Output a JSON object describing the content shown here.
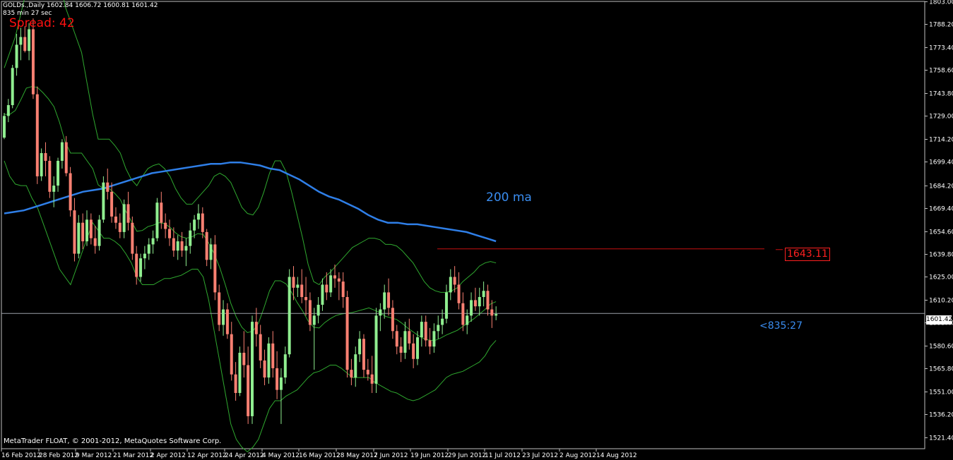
{
  "header": {
    "line1": "GOLDs.,Daily  1602.84 1606.72 1600.81 1601.42",
    "line2": "835 min 27 sec"
  },
  "spread_label": "Spread: 42",
  "ma_label": "200 ma",
  "countdown_label": "<835:27",
  "level_label": "1643.11",
  "copyright": "MetaTrader FLOAT, © 2001-2012, MetaQuotes Software Corp.",
  "current_price_label": "1601.42",
  "colors": {
    "background": "#000000",
    "bull_candle": "#90ee90",
    "bear_candle": "#fa8072",
    "bollinger": "#2fa82f",
    "ma200": "#2f7fe8",
    "level_line": "#c81010",
    "axis": "#c0c0c0",
    "price_line": "#9aa0a8"
  },
  "chart_data": {
    "type": "candlestick",
    "symbol": "GOLDs.",
    "timeframe": "Daily",
    "ylim": [
      1514,
      1803
    ],
    "y_ticks": [
      "1803.00",
      "1788.20",
      "1773.40",
      "1758.60",
      "1743.80",
      "1729.00",
      "1714.20",
      "1699.40",
      "1684.20",
      "1669.40",
      "1654.60",
      "1639.80",
      "1625.00",
      "1610.20",
      "1595.40",
      "1580.60",
      "1565.80",
      "1551.00",
      "1536.20",
      "1521.40"
    ],
    "x_tick_labels": [
      "16 Feb 2012",
      "28 Feb 2012",
      "9 Mar 2012",
      "21 Mar 2012",
      "2 Apr 2012",
      "12 Apr 2012",
      "24 Apr 2012",
      "4 May 2012",
      "16 May 2012",
      "28 May 2012",
      "7 Jun 2012",
      "19 Jun 2012",
      "29 Jun 2012",
      "11 Jul 2012",
      "23 Jul 2012",
      "2 Aug 2012",
      "14 Aug 2012"
    ],
    "x_tick_index": [
      0,
      9,
      18,
      27,
      36,
      45,
      54,
      63,
      72,
      81,
      90,
      99,
      108,
      117,
      126,
      135,
      144
    ],
    "candles": [
      [
        1715,
        1731,
        1714,
        1729
      ],
      [
        1729,
        1740,
        1725,
        1736
      ],
      [
        1736,
        1762,
        1734,
        1760
      ],
      [
        1760,
        1782,
        1755,
        1775
      ],
      [
        1775,
        1786,
        1765,
        1780
      ],
      [
        1780,
        1787,
        1770,
        1771
      ],
      [
        1771,
        1789,
        1765,
        1785
      ],
      [
        1785,
        1792,
        1740,
        1743
      ],
      [
        1743,
        1748,
        1685,
        1690
      ],
      [
        1690,
        1708,
        1687,
        1705
      ],
      [
        1705,
        1712,
        1690,
        1700
      ],
      [
        1700,
        1703,
        1676,
        1680
      ],
      [
        1680,
        1690,
        1670,
        1684
      ],
      [
        1684,
        1702,
        1680,
        1700
      ],
      [
        1700,
        1714,
        1695,
        1712
      ],
      [
        1712,
        1716,
        1690,
        1692
      ],
      [
        1692,
        1696,
        1664,
        1668
      ],
      [
        1668,
        1676,
        1635,
        1640
      ],
      [
        1640,
        1665,
        1637,
        1660
      ],
      [
        1660,
        1666,
        1643,
        1648
      ],
      [
        1648,
        1668,
        1645,
        1662
      ],
      [
        1662,
        1666,
        1646,
        1650
      ],
      [
        1650,
        1658,
        1640,
        1645
      ],
      [
        1645,
        1665,
        1642,
        1662
      ],
      [
        1662,
        1690,
        1660,
        1686
      ],
      [
        1686,
        1695,
        1675,
        1680
      ],
      [
        1680,
        1686,
        1660,
        1664
      ],
      [
        1664,
        1670,
        1656,
        1660
      ],
      [
        1660,
        1666,
        1650,
        1654
      ],
      [
        1654,
        1675,
        1650,
        1672
      ],
      [
        1672,
        1680,
        1655,
        1660
      ],
      [
        1660,
        1664,
        1636,
        1640
      ],
      [
        1640,
        1645,
        1620,
        1625
      ],
      [
        1625,
        1640,
        1622,
        1637
      ],
      [
        1637,
        1645,
        1630,
        1640
      ],
      [
        1640,
        1650,
        1636,
        1646
      ],
      [
        1646,
        1655,
        1640,
        1650
      ],
      [
        1650,
        1676,
        1648,
        1673
      ],
      [
        1673,
        1680,
        1656,
        1660
      ],
      [
        1660,
        1666,
        1650,
        1656
      ],
      [
        1656,
        1662,
        1645,
        1650
      ],
      [
        1650,
        1657,
        1638,
        1642
      ],
      [
        1642,
        1652,
        1636,
        1648
      ],
      [
        1648,
        1654,
        1638,
        1642
      ],
      [
        1642,
        1650,
        1632,
        1645
      ],
      [
        1645,
        1660,
        1640,
        1655
      ],
      [
        1655,
        1665,
        1650,
        1662
      ],
      [
        1662,
        1672,
        1656,
        1666
      ],
      [
        1666,
        1670,
        1650,
        1654
      ],
      [
        1654,
        1656,
        1632,
        1636
      ],
      [
        1636,
        1650,
        1630,
        1646
      ],
      [
        1646,
        1652,
        1610,
        1615
      ],
      [
        1615,
        1620,
        1590,
        1594
      ],
      [
        1594,
        1610,
        1587,
        1604
      ],
      [
        1604,
        1608,
        1585,
        1588
      ],
      [
        1588,
        1596,
        1558,
        1562
      ],
      [
        1562,
        1570,
        1545,
        1550
      ],
      [
        1550,
        1580,
        1548,
        1576
      ],
      [
        1576,
        1590,
        1560,
        1568
      ],
      [
        1568,
        1580,
        1530,
        1535
      ],
      [
        1535,
        1600,
        1530,
        1596
      ],
      [
        1596,
        1605,
        1580,
        1588
      ],
      [
        1588,
        1594,
        1566,
        1571
      ],
      [
        1571,
        1578,
        1555,
        1560
      ],
      [
        1560,
        1586,
        1556,
        1582
      ],
      [
        1582,
        1590,
        1560,
        1566
      ],
      [
        1566,
        1577,
        1546,
        1552
      ],
      [
        1552,
        1566,
        1530,
        1560
      ],
      [
        1560,
        1580,
        1556,
        1575
      ],
      [
        1575,
        1630,
        1573,
        1625
      ],
      [
        1625,
        1632,
        1610,
        1618
      ],
      [
        1618,
        1625,
        1612,
        1620
      ],
      [
        1620,
        1630,
        1608,
        1612
      ],
      [
        1612,
        1625,
        1600,
        1610
      ],
      [
        1610,
        1615,
        1590,
        1594
      ],
      [
        1594,
        1605,
        1565,
        1600
      ],
      [
        1600,
        1612,
        1595,
        1607
      ],
      [
        1607,
        1624,
        1603,
        1620
      ],
      [
        1620,
        1628,
        1610,
        1615
      ],
      [
        1615,
        1630,
        1612,
        1626
      ],
      [
        1626,
        1633,
        1618,
        1624
      ],
      [
        1624,
        1628,
        1610,
        1622
      ],
      [
        1622,
        1628,
        1605,
        1612
      ],
      [
        1612,
        1616,
        1560,
        1565
      ],
      [
        1565,
        1572,
        1555,
        1560
      ],
      [
        1560,
        1580,
        1554,
        1575
      ],
      [
        1575,
        1590,
        1570,
        1585
      ],
      [
        1585,
        1588,
        1560,
        1565
      ],
      [
        1565,
        1572,
        1558,
        1562
      ],
      [
        1562,
        1574,
        1550,
        1556
      ],
      [
        1556,
        1605,
        1550,
        1600
      ],
      [
        1600,
        1608,
        1590,
        1604
      ],
      [
        1604,
        1620,
        1598,
        1615
      ],
      [
        1615,
        1624,
        1600,
        1605
      ],
      [
        1605,
        1610,
        1585,
        1590
      ],
      [
        1590,
        1594,
        1575,
        1580
      ],
      [
        1580,
        1586,
        1570,
        1576
      ],
      [
        1576,
        1596,
        1572,
        1590
      ],
      [
        1590,
        1598,
        1578,
        1582
      ],
      [
        1582,
        1588,
        1566,
        1572
      ],
      [
        1572,
        1590,
        1568,
        1586
      ],
      [
        1586,
        1600,
        1580,
        1596
      ],
      [
        1596,
        1600,
        1580,
        1584
      ],
      [
        1584,
        1592,
        1575,
        1580
      ],
      [
        1580,
        1595,
        1576,
        1590
      ],
      [
        1590,
        1600,
        1585,
        1594
      ],
      [
        1594,
        1604,
        1588,
        1598
      ],
      [
        1598,
        1620,
        1595,
        1615
      ],
      [
        1615,
        1630,
        1610,
        1625
      ],
      [
        1625,
        1632,
        1615,
        1620
      ],
      [
        1620,
        1628,
        1604,
        1608
      ],
      [
        1608,
        1615,
        1590,
        1594
      ],
      [
        1594,
        1604,
        1588,
        1600
      ],
      [
        1600,
        1615,
        1596,
        1610
      ],
      [
        1610,
        1618,
        1603,
        1606
      ],
      [
        1606,
        1618,
        1600,
        1612
      ],
      [
        1612,
        1622,
        1606,
        1616
      ],
      [
        1616,
        1620,
        1600,
        1604
      ],
      [
        1604,
        1610,
        1592,
        1600
      ],
      [
        1600,
        1606,
        1597,
        1601
      ]
    ],
    "bollinger_upper": [
      1760,
      1770,
      1780,
      1795,
      1810,
      1820,
      1825,
      1828,
      1830,
      1830,
      1820,
      1800,
      1790,
      1780,
      1770,
      1750,
      1730,
      1714,
      1714,
      1714,
      1710,
      1705,
      1695,
      1688,
      1684,
      1690,
      1695,
      1697,
      1698,
      1695,
      1690,
      1682,
      1676,
      1672,
      1672,
      1676,
      1680,
      1684,
      1690,
      1692,
      1690,
      1686,
      1678,
      1670,
      1666,
      1665,
      1670,
      1680,
      1692,
      1700,
      1700,
      1693,
      1680,
      1665,
      1650,
      1633,
      1622,
      1620,
      1625,
      1628,
      1632,
      1636,
      1640,
      1644,
      1646,
      1648,
      1650,
      1650,
      1649,
      1646,
      1646,
      1645,
      1642,
      1638,
      1634,
      1628,
      1622,
      1618,
      1616,
      1615,
      1615,
      1616,
      1618,
      1622,
      1625,
      1628,
      1632,
      1634,
      1635,
      1634
    ],
    "bollinger_lower": [
      1700,
      1690,
      1685,
      1684,
      1684,
      1676,
      1670,
      1660,
      1650,
      1640,
      1630,
      1625,
      1620,
      1630,
      1640,
      1650,
      1660,
      1655,
      1650,
      1650,
      1648,
      1645,
      1640,
      1634,
      1625,
      1620,
      1620,
      1620,
      1622,
      1624,
      1624,
      1625,
      1626,
      1628,
      1630,
      1630,
      1625,
      1610,
      1590,
      1570,
      1550,
      1530,
      1520,
      1515,
      1512,
      1515,
      1520,
      1530,
      1540,
      1545,
      1545,
      1548,
      1550,
      1552,
      1556,
      1560,
      1563,
      1564,
      1566,
      1568,
      1568,
      1566,
      1563,
      1560,
      1560,
      1560,
      1560,
      1557,
      1555,
      1553,
      1551,
      1550,
      1548,
      1546,
      1545,
      1546,
      1548,
      1550,
      1552,
      1556,
      1560,
      1562,
      1563,
      1564,
      1566,
      1568,
      1570,
      1574,
      1580,
      1584
    ],
    "ma200": [
      1666,
      1667,
      1668,
      1670,
      1672,
      1674,
      1676,
      1678,
      1680,
      1681,
      1682,
      1684,
      1686,
      1688,
      1690,
      1692,
      1693,
      1694,
      1695,
      1696,
      1697,
      1698,
      1698,
      1699,
      1699,
      1698,
      1697,
      1695,
      1694,
      1691,
      1688,
      1684,
      1680,
      1677,
      1675,
      1672,
      1669,
      1665,
      1662,
      1660,
      1660,
      1659,
      1659,
      1658,
      1657,
      1656,
      1655,
      1654,
      1652,
      1650,
      1648
    ],
    "horizontal_levels": [
      1643.11
    ],
    "current_price": 1601.42
  }
}
